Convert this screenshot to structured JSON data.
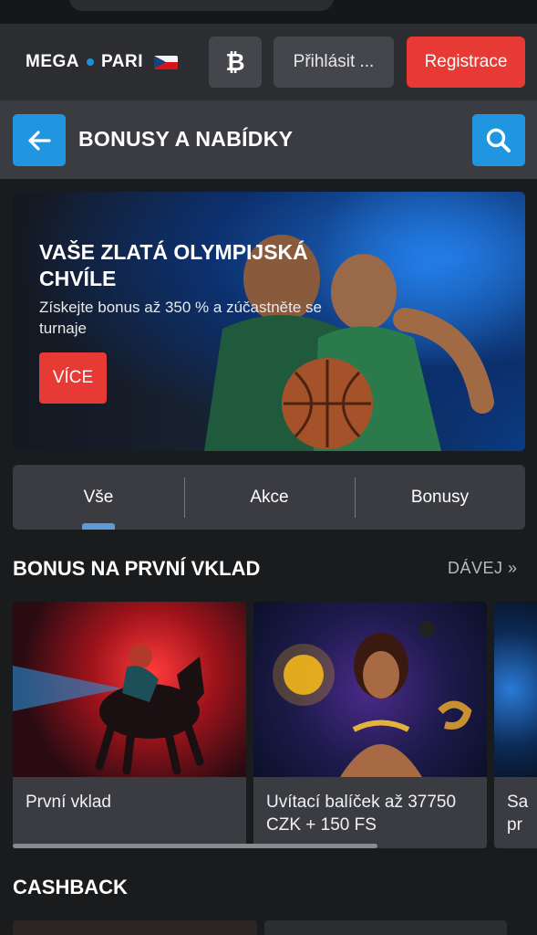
{
  "header": {
    "logo_text_left": "MEGA",
    "logo_text_right": "PARI",
    "crypto_symbol": "₿",
    "login_label": "Přihlásit ...",
    "register_label": "Registrace"
  },
  "titlebar": {
    "title": "BONUSY A NABÍDKY"
  },
  "banner": {
    "title": "VAŠE ZLATÁ OLYMPIJSKÁ CHVÍLE",
    "subtitle": "Získejte bonus až 350 % a zúčastněte se turnaje",
    "button_label": "VÍCE"
  },
  "tabs": [
    {
      "label": "Vše"
    },
    {
      "label": "Akce"
    },
    {
      "label": "Bonusy"
    }
  ],
  "first_deposit": {
    "title": "BONUS NA PRVNÍ VKLAD",
    "see_all": "DÁVEJ »",
    "cards": [
      {
        "label": "První vklad"
      },
      {
        "label": "Uvítací balíček až 37750 CZK + 150 FS"
      },
      {
        "label": "Sa pr"
      }
    ]
  },
  "cashback": {
    "title": "CASHBACK"
  },
  "colors": {
    "accent_blue": "#2196e0",
    "accent_red": "#e83a35",
    "panel": "#3b3c41",
    "background": "#1a1b1d"
  }
}
